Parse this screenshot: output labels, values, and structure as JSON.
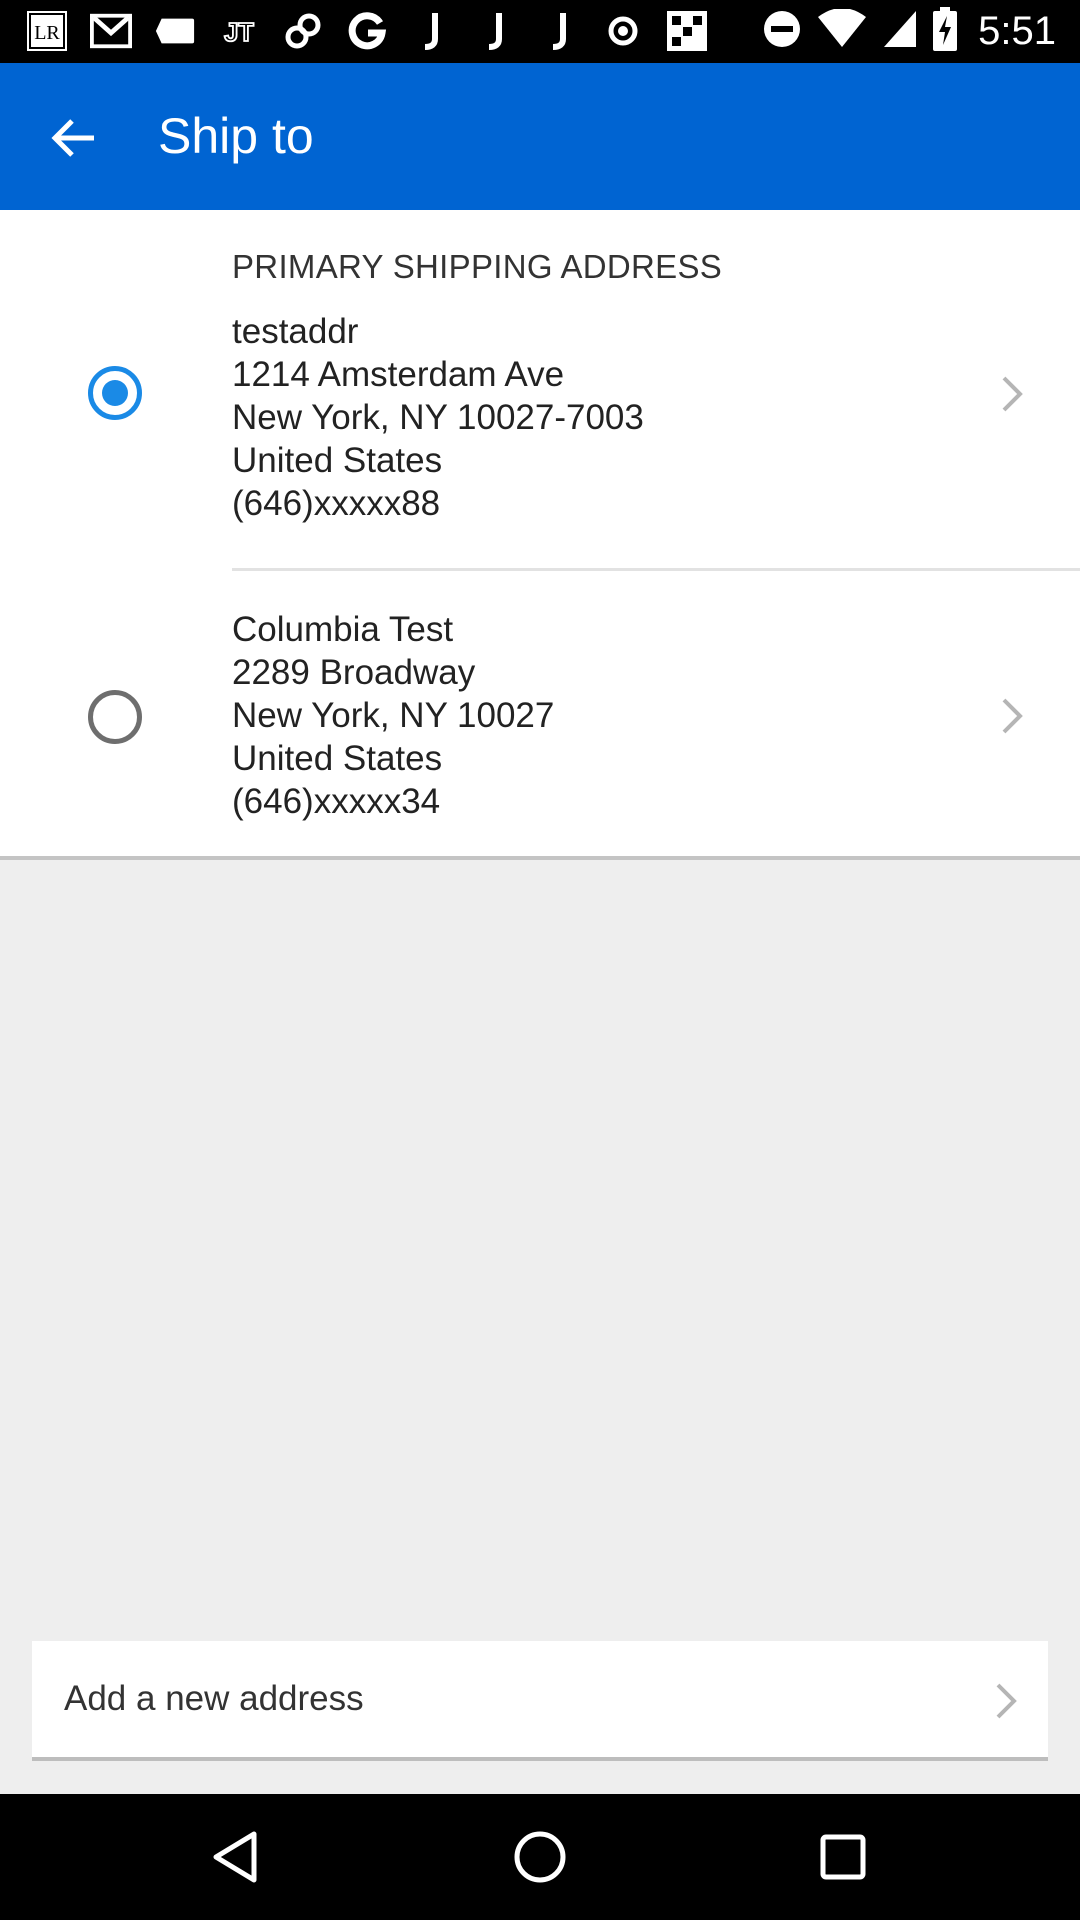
{
  "status_bar": {
    "time": "5:51",
    "left_icons": [
      "lr-app-icon",
      "gmail-icon",
      "tag-icon",
      "jt-app-icon",
      "link-icon",
      "google-icon",
      "j-app-icon",
      "j-app-icon",
      "j-app-icon",
      "circle-dot-icon",
      "grid-app-icon"
    ],
    "right_icons": [
      "do-not-disturb-icon",
      "wifi-icon",
      "cell-signal-icon",
      "battery-charging-icon"
    ],
    "lr_label": "LR"
  },
  "app_bar": {
    "title": "Ship to",
    "color": "#0064d2"
  },
  "addresses": {
    "section_label": "PRIMARY SHIPPING ADDRESS",
    "items": [
      {
        "selected": true,
        "name": "testaddr",
        "street": "1214 Amsterdam Ave",
        "city_line": "New York, NY 10027-7003",
        "country": "United States",
        "phone": "(646)xxxxx88"
      },
      {
        "selected": false,
        "name": "Columbia Test",
        "street": "2289 Broadway",
        "city_line": "New York, NY 10027",
        "country": "United States",
        "phone": "(646)xxxxx34"
      }
    ]
  },
  "add_address": {
    "label": "Add a new address"
  },
  "nav_bar": {
    "buttons": [
      "back-triangle-icon",
      "home-circle-icon",
      "recents-square-icon"
    ]
  }
}
